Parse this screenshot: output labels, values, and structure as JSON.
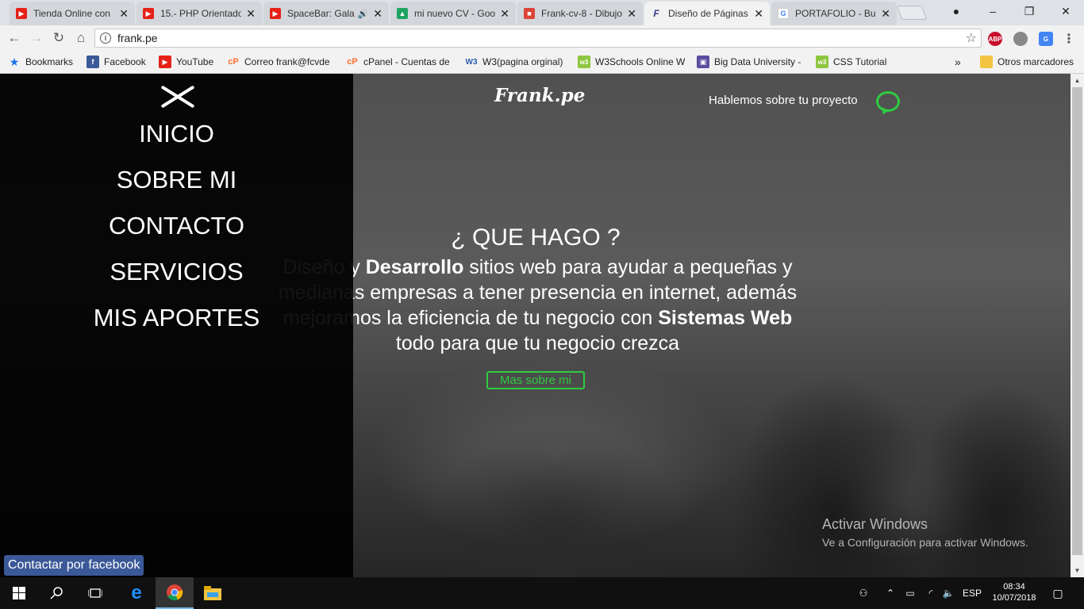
{
  "browser": {
    "tabs": [
      {
        "title": "Tienda Online con",
        "icon": "youtube-icon",
        "color": "#e62117",
        "active": false,
        "audio": false
      },
      {
        "title": "15.- PHP Orientado",
        "icon": "youtube-icon",
        "color": "#e62117",
        "active": false,
        "audio": false
      },
      {
        "title": "SpaceBar: Gala",
        "icon": "youtube-icon",
        "color": "#e62117",
        "active": false,
        "audio": true
      },
      {
        "title": "mi nuevo CV - Goo",
        "icon": "google-drive-icon",
        "color": "#1fa463",
        "active": false,
        "audio": false
      },
      {
        "title": "Frank-cv-8 - Dibujo",
        "icon": "drawing-icon",
        "color": "#db4437",
        "active": false,
        "audio": false
      },
      {
        "title": "Diseño de Páginas",
        "icon": "frank-favicon-icon",
        "color": "#3b3b8f",
        "active": true,
        "audio": false
      },
      {
        "title": "PORTAFOLIO - Bus",
        "icon": "google-icon",
        "color": "#4285f4",
        "active": false,
        "audio": false
      }
    ],
    "close_glyph": "✕",
    "url": "frank.pe",
    "bookmarks": [
      {
        "label": "Bookmarks",
        "icon": "star-icon"
      },
      {
        "label": "Facebook",
        "icon": "facebook-icon"
      },
      {
        "label": "YouTube",
        "icon": "youtube-icon"
      },
      {
        "label": "Correo frank@fcvde",
        "icon": "cpanel-icon"
      },
      {
        "label": "cPanel - Cuentas de",
        "icon": "cpanel-icon"
      },
      {
        "label": "W3(pagina orginal)",
        "icon": "w3-icon"
      },
      {
        "label": "W3Schools Online W",
        "icon": "w3schools-icon"
      },
      {
        "label": "Big Data University -",
        "icon": "bigdata-icon"
      },
      {
        "label": "CSS Tutorial",
        "icon": "w3schools-icon"
      }
    ],
    "more_bookmarks": "»",
    "other_bookmarks": "Otros marcadores"
  },
  "page": {
    "logo": "Frank.pe",
    "talk_link": "Hablemos sobre tu proyecto",
    "hero_title": "¿ QUE HAGO ?",
    "hero_parts": {
      "p1": "Diseño y ",
      "b1": "Desarrollo",
      "p2": " sitios web para ayudar a pequeñas y medianas empresas a tener presencia en internet, además mejoramos la eficiencia de tu negocio con ",
      "b2": "Sistemas Web",
      "p3": " todo para que tu negocio crezca"
    },
    "more_button": "Mas sobre mi",
    "menu": [
      "INICIO",
      "SOBRE MI",
      "CONTACTO",
      "SERVICIOS",
      "MIS APORTES"
    ],
    "facebook_button": "Contactar por facebook",
    "accent": "#2ecc40"
  },
  "watermark": {
    "title": "Activar Windows",
    "subtitle": "Ve a Configuración para activar Windows."
  },
  "taskbar": {
    "lang": "ESP",
    "time": "08:34",
    "date": "10/07/2018"
  }
}
